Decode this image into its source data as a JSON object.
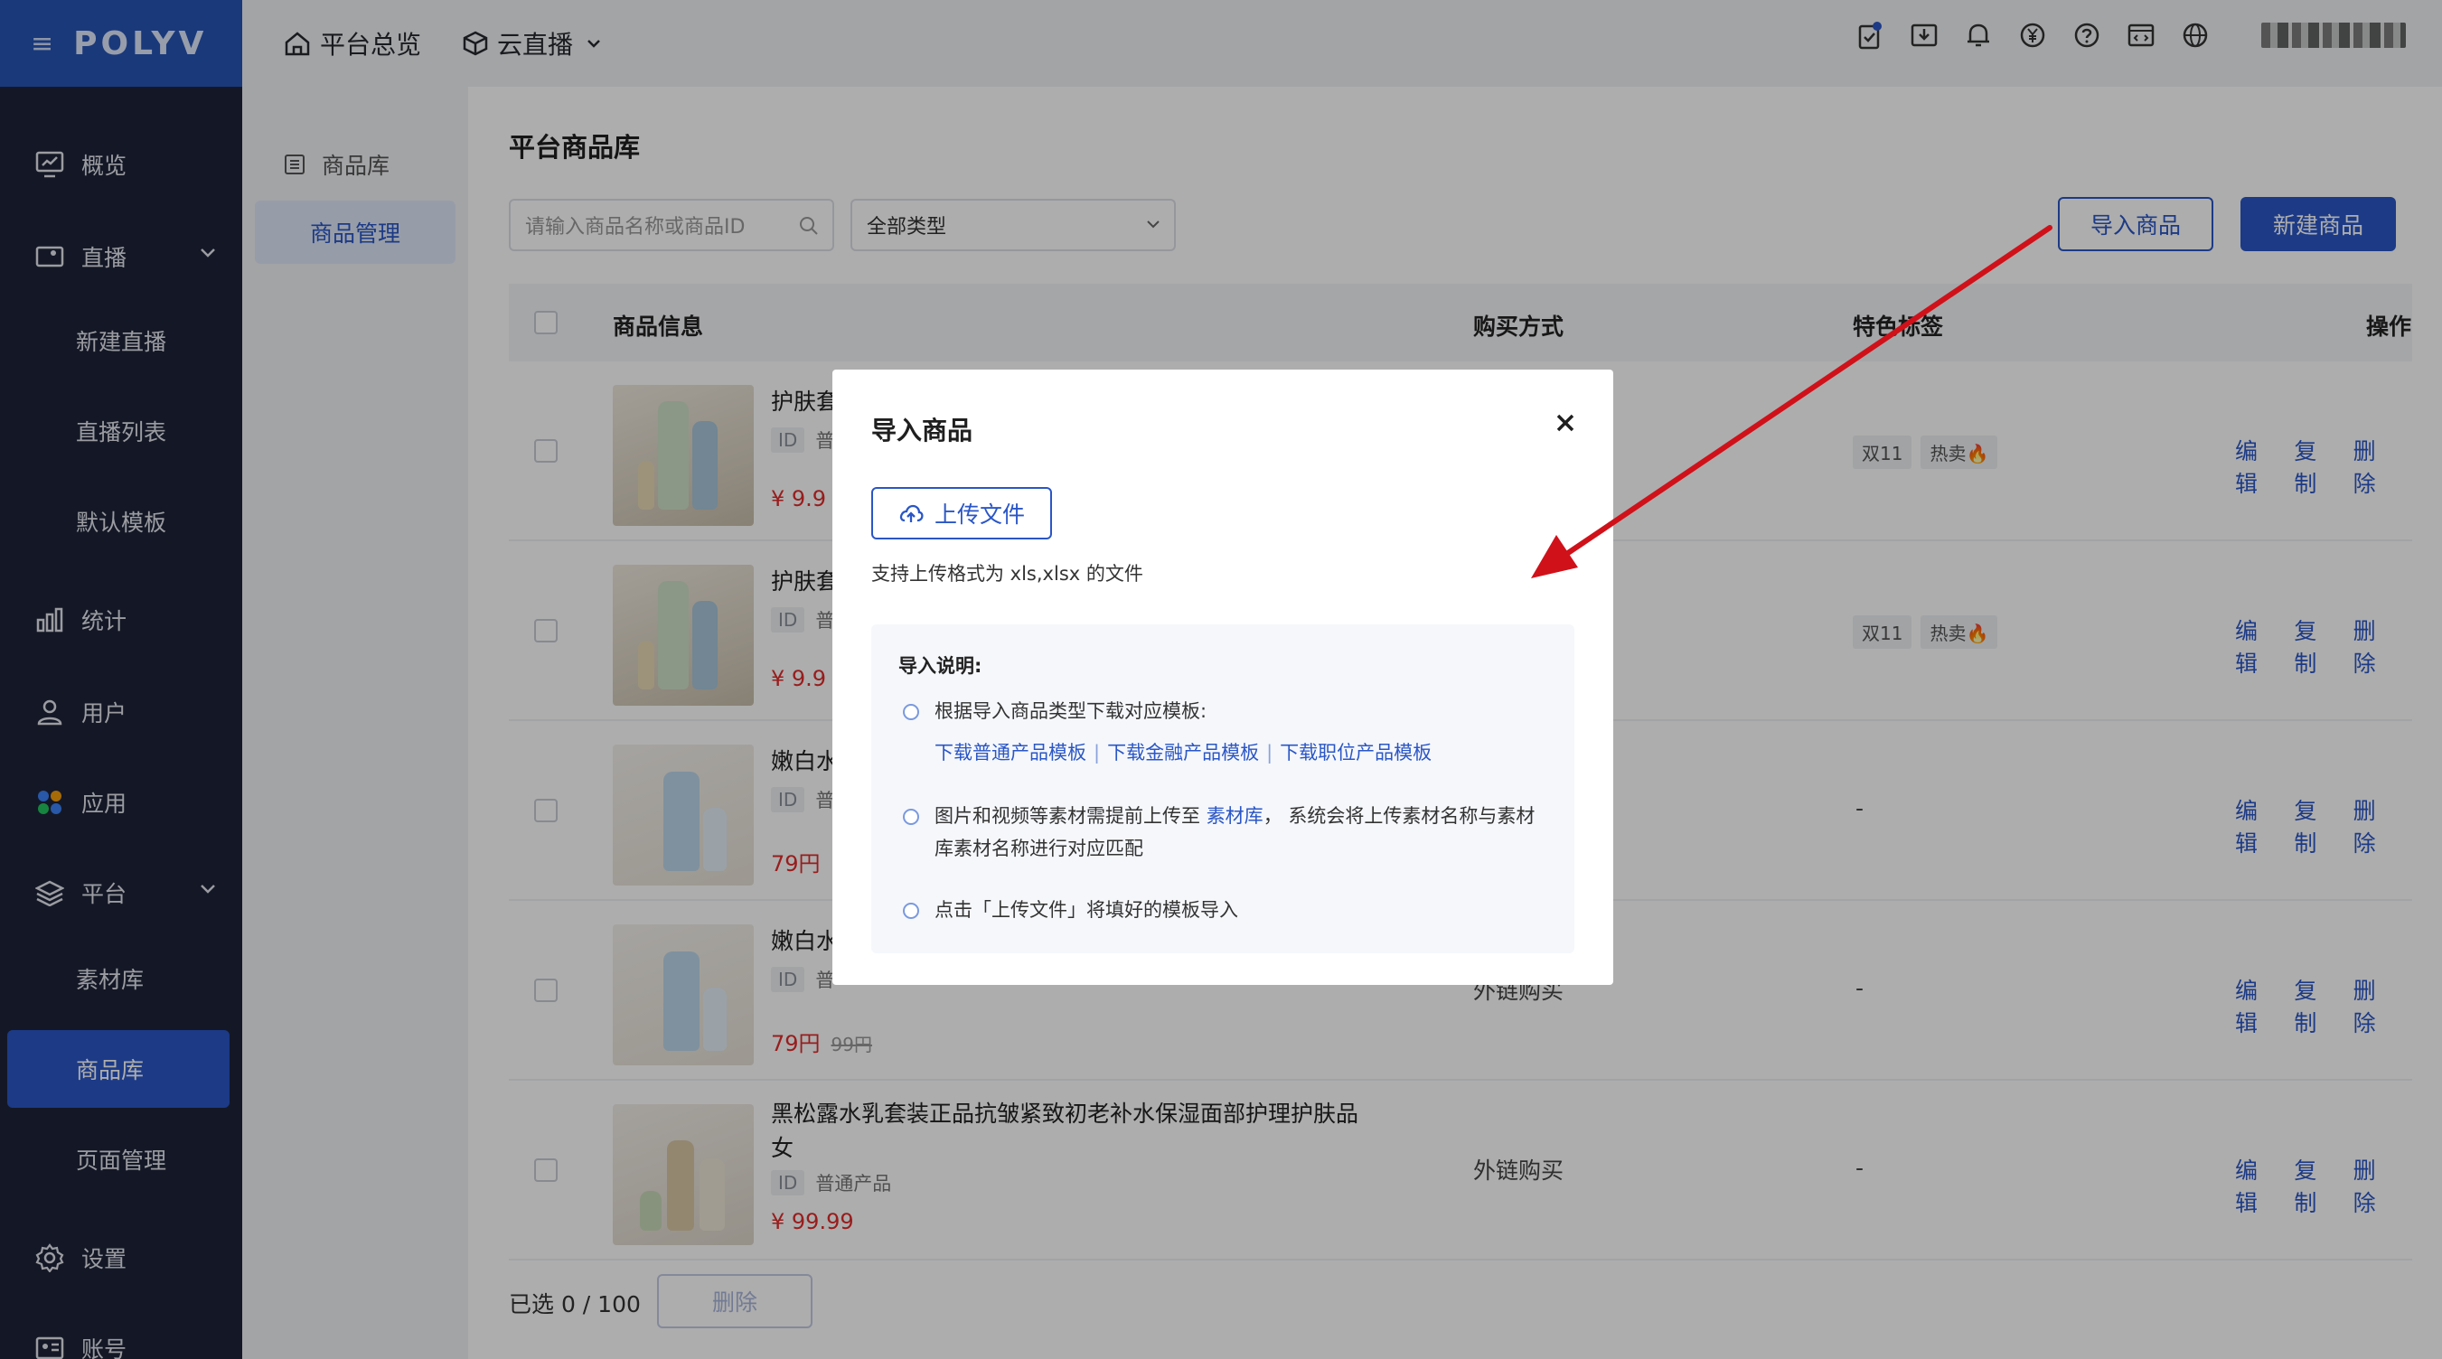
{
  "logo": "POLYV",
  "sidebar": {
    "items": [
      {
        "label": "概览",
        "icon": "monitor-icon"
      },
      {
        "label": "直播",
        "icon": "video-icon"
      },
      {
        "label": "新建直播"
      },
      {
        "label": "直播列表"
      },
      {
        "label": "默认模板"
      },
      {
        "label": "统计",
        "icon": "bar-chart-icon"
      },
      {
        "label": "用户",
        "icon": "user-icon"
      },
      {
        "label": "应用",
        "icon": "apps-icon"
      },
      {
        "label": "平台",
        "icon": "layers-icon"
      },
      {
        "label": "素材库"
      },
      {
        "label": "商品库"
      },
      {
        "label": "页面管理"
      },
      {
        "label": "设置",
        "icon": "gear-icon"
      },
      {
        "label": "账号",
        "icon": "id-card-icon"
      }
    ]
  },
  "topbar": {
    "tab_overview": "平台总览",
    "tab_live": "云直播"
  },
  "subnav": {
    "items": [
      "商品库",
      "商品管理"
    ]
  },
  "main": {
    "title": "平台商品库",
    "search_placeholder": "请输入商品名称或商品ID",
    "type_select": "全部类型",
    "import_button": "导入商品",
    "new_button": "新建商品",
    "columns": [
      "商品信息",
      "购买方式",
      "特色标签",
      "操作"
    ],
    "rows": [
      {
        "name": "护肤套",
        "id_label": "ID",
        "type": "普",
        "price": "¥ 9.9",
        "old_price": "",
        "buy": "",
        "tags": [
          "双11",
          "热卖🔥"
        ]
      },
      {
        "name": "护肤套",
        "id_label": "ID",
        "type": "普",
        "price": "¥ 9.9",
        "old_price": "",
        "buy": "",
        "tags": [
          "双11",
          "热卖🔥"
        ]
      },
      {
        "name": "嫩白水",
        "id_label": "ID",
        "type": "普",
        "price": "79円",
        "old_price": "",
        "buy": "",
        "tags": [],
        "dash": "-"
      },
      {
        "name": "嫩白水",
        "id_label": "ID",
        "type": "普",
        "price": "79円",
        "old_price": "99円",
        "buy": "外链购买",
        "tags": [],
        "dash": "-"
      },
      {
        "name": "黑松露水乳套装正品抗皱紧致初老补水保湿面部护理护肤品女",
        "id_label": "ID",
        "type": "普通产品",
        "price": "¥ 99.99",
        "old_price": "",
        "buy": "外链购买",
        "tags": [],
        "dash": "-"
      }
    ],
    "ops": [
      "编辑",
      "复制",
      "删除"
    ],
    "selected": "已选 0 / 100",
    "delete_button": "删除"
  },
  "modal": {
    "title": "导入商品",
    "upload_button": "上传文件",
    "upload_hint": "支持上传格式为 xls,xlsx 的文件",
    "notes_title": "导入说明:",
    "note1": "根据导入商品类型下载对应模板:",
    "link_normal": "下载普通产品模板",
    "link_finance": "下载金融产品模板",
    "link_job": "下载职位产品模板",
    "note2_prefix": "图片和视频等素材需提前上传至 ",
    "note2_link": "素材库",
    "note2_suffix": "， 系统会将上传素材名称与素材库素材名称进行对应匹配",
    "note3": "点击「上传文件」将填好的模板导入"
  },
  "colors": {
    "accent": "#2a56c6",
    "sidebar_bg": "#1e2439",
    "logo_bg": "#2754b6",
    "price": "#e02b2b",
    "annotation_arrow": "#d0111a"
  }
}
